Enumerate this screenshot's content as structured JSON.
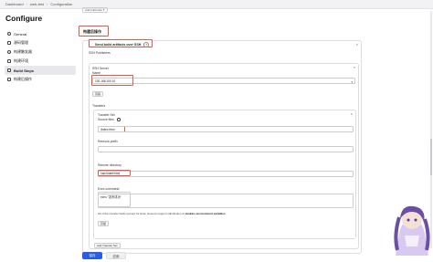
{
  "breadcrumb": [
    "Dashboard",
    "web-test",
    "Configuration"
  ],
  "page_title": "Configure",
  "sidebar": {
    "items": [
      {
        "label": "General",
        "icon": "gear-icon"
      },
      {
        "label": "源码管理",
        "icon": "branch-icon"
      },
      {
        "label": "构建触发器",
        "icon": "clock-icon"
      },
      {
        "label": "构建环境",
        "icon": "box-icon"
      },
      {
        "label": "Build Steps",
        "icon": "steps-icon",
        "active": true
      },
      {
        "label": "构建后操作",
        "icon": "post-icon"
      }
    ]
  },
  "main": {
    "top_select": "Add build step ▾",
    "section_heading": "构建后操作",
    "step_title": "Send build artifacts over SSH",
    "step_help": "?",
    "ssh_publishers_label": "SSH Publishers",
    "ssh_server_label": "SSH Server",
    "name_label": "Name",
    "name_value": "192.168.100.10",
    "advanced_label": "高级",
    "transfers_label": "Transfers",
    "transfer_set_label": "Transfer Set",
    "source_files_label": "Source files",
    "source_files_value": "/index.html",
    "remove_prefix_label": "Remove prefix",
    "remove_prefix_value": "",
    "remote_directory_label": "Remote directory",
    "remote_directory_value": "/usr/share/html",
    "exec_command_label": "Exec command",
    "exec_command_value": "echo \"发布成功\"",
    "note_text": "All of the transfer fields (except for Exec timeout) support substitution of",
    "note_link": "Jenkins environment variables",
    "transfer_advanced_label": "高级",
    "add_transfer_set_label": "Add Transfer Set"
  },
  "footer": {
    "save_label": "保存",
    "apply_label": "应用"
  },
  "colors": {
    "accent": "#2b5ce6",
    "highlight": "#e1584b"
  }
}
